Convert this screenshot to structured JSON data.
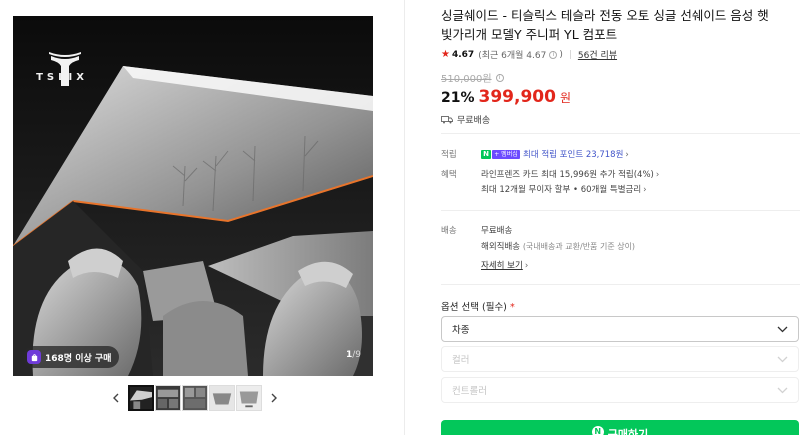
{
  "gallery": {
    "brand_text": "TSLIX",
    "buyers_badge": "168명 이상 구매",
    "page_current": "1",
    "page_total": "/9",
    "thumbnail_count": 5,
    "active_thumbnail": 1
  },
  "product": {
    "title": "싱글쉐이드 - 티슬릭스 테슬라 전동 오토 싱글 선쉐이드 음성 햇빛가리개 모델Y 주니퍼 YL 컴포트",
    "rating_star": "★",
    "rating": "4.67",
    "rating_recent": "(최근 6개월 4.67",
    "rating_recent_end": ")",
    "review_count": "56건 리뷰",
    "original_price": "510,000원",
    "discount": "21%",
    "price": "399,900",
    "price_unit": "원",
    "shipping_badge": "무료배송"
  },
  "benefits": {
    "points_key": "적립",
    "npay_n": "N",
    "npay_plus": "+ 멤버십",
    "points_text": "최대 적립 포인트 23,718원",
    "benefit_key": "혜택",
    "card_benefit": "라인프렌즈 카드 최대 15,996원 추가 적립(4%)",
    "installment": "최대 12개월 무이자 할부 • 60개월 특별금리"
  },
  "delivery": {
    "key": "배송",
    "free": "무료배송",
    "overseas": "해외직배송",
    "overseas_note": "(국내배송과 교환/반품 기준 상이)",
    "detail_link": "자세히 보기"
  },
  "options": {
    "label": "옵션 선택 (필수)",
    "required_mark": "*",
    "select_1": "차종",
    "select_2": "컬러",
    "select_3": "컨트롤러"
  },
  "actions": {
    "buy_icon": "N",
    "buy_label": "구매하기"
  },
  "colors": {
    "price_red": "#e2261b",
    "naver_green": "#03c75a",
    "membership_purple": "#6c4bff",
    "link_blue": "#4255c9"
  }
}
